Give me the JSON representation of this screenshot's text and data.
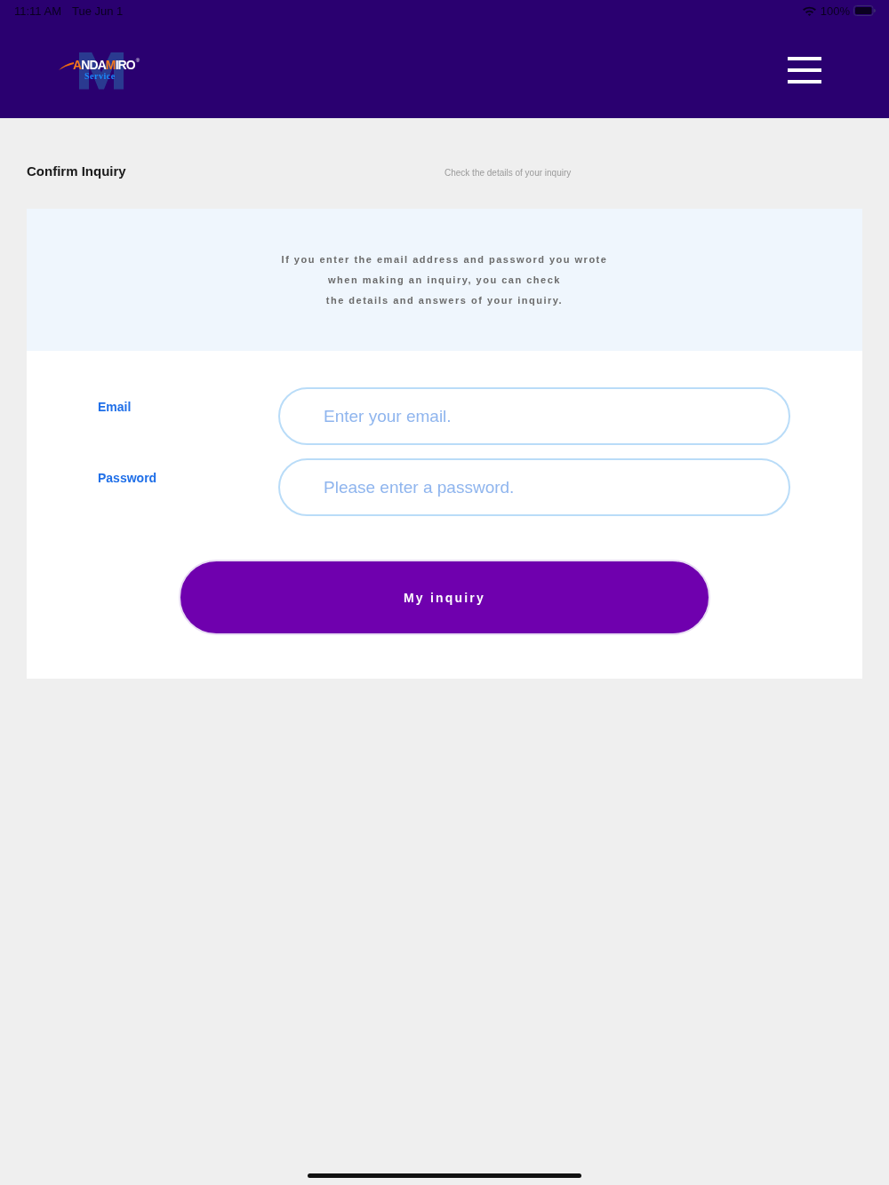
{
  "status_bar": {
    "time": "11:11 AM",
    "date": "Tue Jun 1",
    "battery": "100%"
  },
  "header": {
    "logo": {
      "wordmark": [
        {
          "text": "A",
          "color": "#f47a20"
        },
        {
          "text": "NDA",
          "color": "#ffffff"
        },
        {
          "text": "M",
          "color": "#f47a20"
        },
        {
          "text": "IRO",
          "color": "#ffffff"
        }
      ],
      "registered": "®",
      "subtitle": "Service"
    }
  },
  "page": {
    "title": "Confirm Inquiry",
    "subtitle": "Check the details of your inquiry"
  },
  "notice": {
    "lines": [
      "If you enter the email address and password you wrote",
      "when making an inquiry, you can check",
      "the details and answers of your inquiry."
    ]
  },
  "form": {
    "fields": [
      {
        "label": "Email",
        "placeholder": "Enter your email."
      },
      {
        "label": "Password",
        "placeholder": "Please enter a password."
      }
    ],
    "submit": "My inquiry"
  }
}
